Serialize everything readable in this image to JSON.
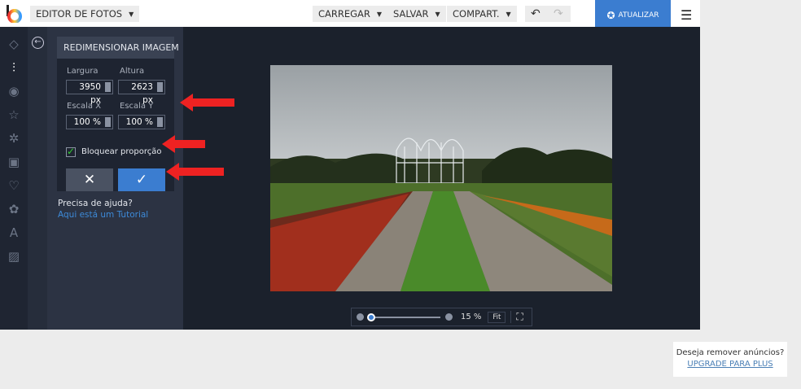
{
  "topbar": {
    "editor": "EDITOR DE FOTOS",
    "load": "CARREGAR",
    "save": "SALVAR",
    "share": "COMPART.",
    "upgrade": "ATUALIZAR"
  },
  "panel": {
    "title": "REDIMENSIONAR IMAGEM",
    "width_label": "Largura",
    "height_label": "Altura",
    "width": "3950 px",
    "height": "2623 px",
    "scalex_label": "Escala X",
    "scaley_label": "Escala Y",
    "scalex": "100 %",
    "scaley": "100 %",
    "lock_label": "Bloquear proporção",
    "lock_checked": true,
    "help": "Precisa de ajuda?",
    "tutorial": "Aqui está um Tutorial"
  },
  "zoom": {
    "value": "15 %",
    "fit": "Fit",
    "level_percent": 15
  },
  "ad": {
    "text": "Deseja remover anúncios?",
    "link": "UPGRADE PARA PLUS"
  },
  "colors": {
    "accent": "#3b7dd0",
    "annotation": "#e22222"
  }
}
